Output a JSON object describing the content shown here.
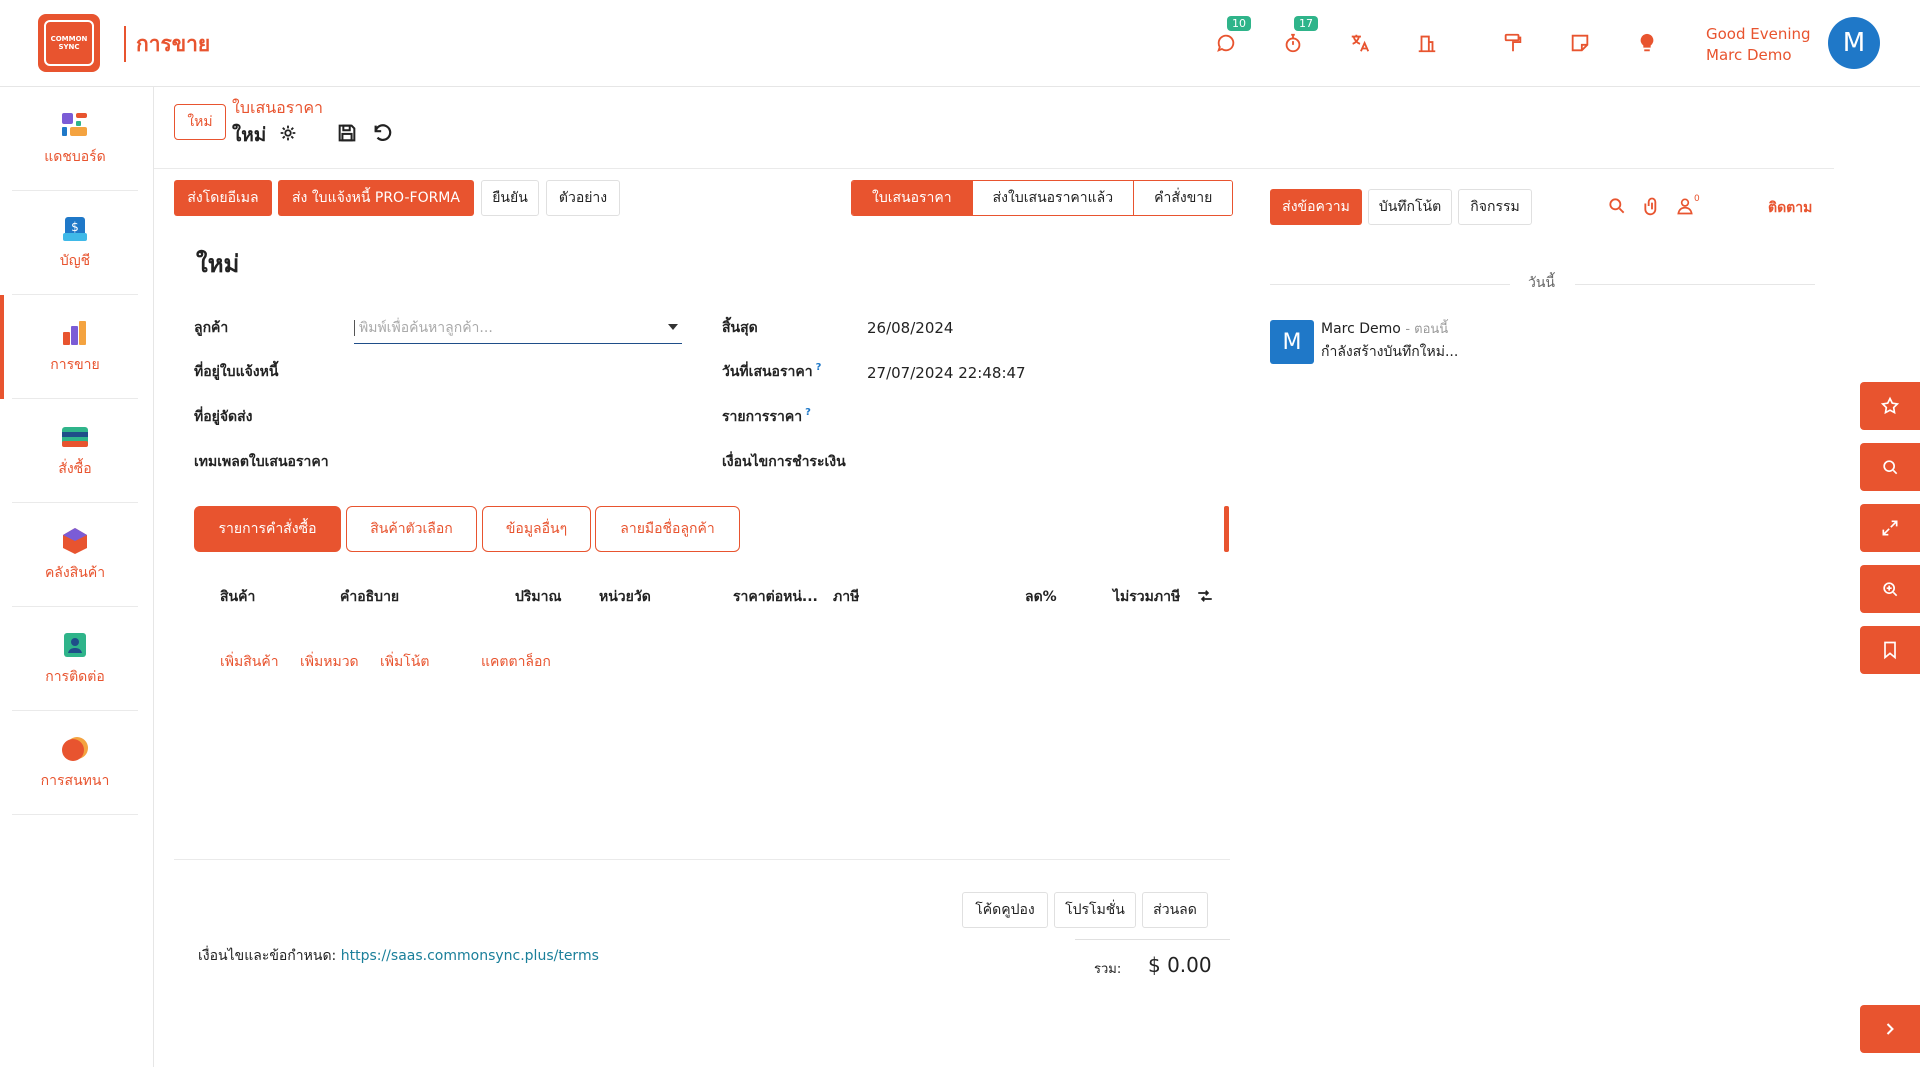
{
  "topbar": {
    "app_title": "การขาย",
    "logo_text_line1": "COMMON",
    "logo_text_line2": "SYNC",
    "messages_badge": "10",
    "activities_badge": "17",
    "greeting_line1": "Good Evening",
    "greeting_line2": "Marc Demo",
    "avatar_initial": "M"
  },
  "sidebar": {
    "items": [
      {
        "label": "แดชบอร์ด",
        "icon": "dashboard-icon"
      },
      {
        "label": "บัญชี",
        "icon": "accounting-icon"
      },
      {
        "label": "การขาย",
        "icon": "sales-icon"
      },
      {
        "label": "สั่งซื้อ",
        "icon": "purchase-icon"
      },
      {
        "label": "คลังสินค้า",
        "icon": "inventory-icon"
      },
      {
        "label": "การติดต่อ",
        "icon": "contacts-icon"
      },
      {
        "label": "การสนทนา",
        "icon": "discuss-icon"
      }
    ]
  },
  "header": {
    "new_button": "ใหม่",
    "breadcrumb_parent": "ใบเสนอราคา",
    "breadcrumb_current": "ใหม่"
  },
  "actions": {
    "send_email": "ส่งโดยอีเมล",
    "send_proforma": "ส่ง ใบแจ้งหนี้ PRO-FORMA",
    "confirm": "ยืนยัน",
    "preview": "ตัวอย่าง"
  },
  "status_steps": [
    "ใบเสนอราคา",
    "ส่งใบเสนอราคาแล้ว",
    "คำสั่งขาย"
  ],
  "form": {
    "title": "ใหม่",
    "customer_label": "ลูกค้า",
    "customer_placeholder": "พิมพ์เพื่อค้นหาลูกค้า...",
    "invoice_address_label": "ที่อยู่ใบแจ้งหนี้",
    "delivery_address_label": "ที่อยู่จัดส่ง",
    "quote_template_label": "เทมเพลตใบเสนอราคา",
    "expiration_label": "สิ้นสุด",
    "expiration_value": "26/08/2024",
    "quotation_date_label": "วันที่เสนอราคา",
    "quotation_date_value": "27/07/2024 22:48:47",
    "pricelist_label": "รายการราคา",
    "payment_terms_label": "เงื่อนไขการชำระเงิน",
    "help_mark": "?"
  },
  "tabs": [
    "รายการคำสั่งซื้อ",
    "สินค้าตัวเลือก",
    "ข้อมูลอื่นๆ",
    "ลายมือชื่อลูกค้า"
  ],
  "order_lines": {
    "columns": [
      "สินค้า",
      "คำอธิบาย",
      "ปริมาณ",
      "หน่วยวัด",
      "ราคาต่อหน่...",
      "ภาษี",
      "ลด%",
      "ไม่รวมภาษี"
    ],
    "add_product": "เพิ่มสินค้า",
    "add_section": "เพิ่มหมวด",
    "add_note": "เพิ่มโน้ต",
    "catalog": "แคตตาล็อก"
  },
  "footer_buttons": {
    "coupon": "โค้ดคูปอง",
    "promotion": "โปรโมชั่น",
    "discount": "ส่วนลด"
  },
  "terms": {
    "label": "เงื่อนไขและข้อกำหนด:",
    "link": "https://saas.commonsync.plus/terms"
  },
  "totals": {
    "label": "รวม:",
    "value": "$ 0.00"
  },
  "chatter": {
    "send_message": "ส่งข้อความ",
    "log_note": "บันทึกโน้ต",
    "activities": "กิจกรรม",
    "followers_count": "0",
    "follow": "ติดตาม",
    "date_separator": "วันนี้",
    "message_author": "Marc Demo",
    "message_time": "- ตอนนี้",
    "message_body": "กำลังสร้างบันทึกใหม่...",
    "message_avatar": "M"
  },
  "colors": {
    "accent": "#e8542f",
    "avatar_blue": "#1f78c8",
    "badge_green": "#2fb48a",
    "link": "#1a7f9a"
  }
}
